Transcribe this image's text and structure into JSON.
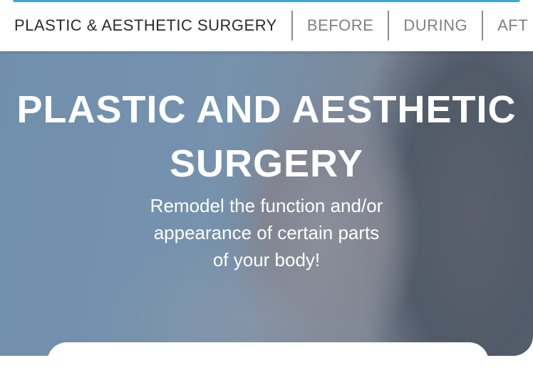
{
  "nav": {
    "tabs": [
      {
        "label": "PLASTIC & AESTHETIC SURGERY",
        "active": true
      },
      {
        "label": "BEFORE",
        "active": false
      },
      {
        "label": "DURING",
        "active": false
      },
      {
        "label": "AFT",
        "active": false
      }
    ],
    "accent_color": "#3aa6e0"
  },
  "hero": {
    "title_line1": "PLASTIC AND AESTHETIC",
    "title_line2": "SURGERY",
    "subtitle_line1": "Remodel the function and/or",
    "subtitle_line2": "appearance of certain parts",
    "subtitle_line3": "of your body!",
    "overlay_color": "#4a7096"
  }
}
